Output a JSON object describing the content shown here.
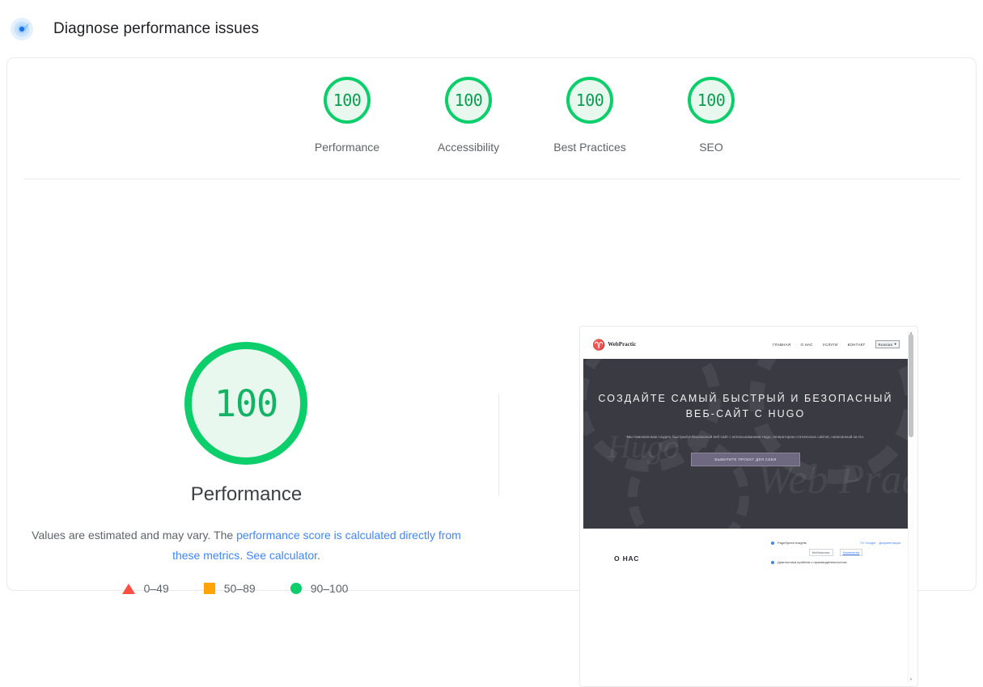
{
  "header": {
    "icon": "lighthouse-radar-icon",
    "title": "Diagnose performance issues"
  },
  "colors": {
    "pass": "#0cce6b",
    "pass_fill": "#e9f8ef",
    "average": "#ffa400",
    "fail": "#ff4e42",
    "link": "#4285f4"
  },
  "category_gauges": [
    {
      "score": "100",
      "label": "Performance"
    },
    {
      "score": "100",
      "label": "Accessibility"
    },
    {
      "score": "100",
      "label": "Best Practices"
    },
    {
      "score": "100",
      "label": "SEO"
    }
  ],
  "detail": {
    "score": "100",
    "title": "Performance",
    "disclaimer": {
      "text_1": "Values are estimated and may vary. The ",
      "link_1": "performance score is calculated directly from these metrics",
      "text_2": ". ",
      "link_2": "See calculator",
      "text_3": "."
    },
    "legend": [
      {
        "swatch": "triangle",
        "range": "0–49"
      },
      {
        "swatch": "square",
        "range": "50–89"
      },
      {
        "swatch": "circle",
        "range": "90–100"
      }
    ]
  },
  "screenshot": {
    "site": {
      "logo_mark": "♈",
      "logo_text": "WebPractic",
      "nav": [
        "ГЛАВНАЯ",
        "О НАС",
        "УСЛУГИ",
        "КОНТАКТ"
      ],
      "language_selected": "Russian",
      "language_caret": "▾",
      "hero_title": "СОЗДАЙТЕ САМЫЙ БЫСТРЫЙ И БЕЗОПАСНЫЙ ВЕБ-САЙТ С HUGO",
      "hero_subtitle": "Мы поможем вам создать быстрый и безопасный веб-сайт с использованием Hugo, генератором статических сайтов, написанный на Go.",
      "hero_button": "ВЫБЕРИТЕ ПРОЕКТ ДЛЯ СЕБЯ",
      "watermark_1": "Hugo",
      "watermark_2": "Web Practic",
      "about_title": "О НАС"
    },
    "psi_widget": {
      "title": "PageSpeed Insights",
      "action_1": "От Google",
      "action_2": "Документация",
      "chip_1": "Мобильные",
      "chip_2": "Компьютер",
      "footer": "Диагностика проблем с производительностью"
    },
    "scrollbar": {
      "up": "▴",
      "down": "▾"
    }
  }
}
